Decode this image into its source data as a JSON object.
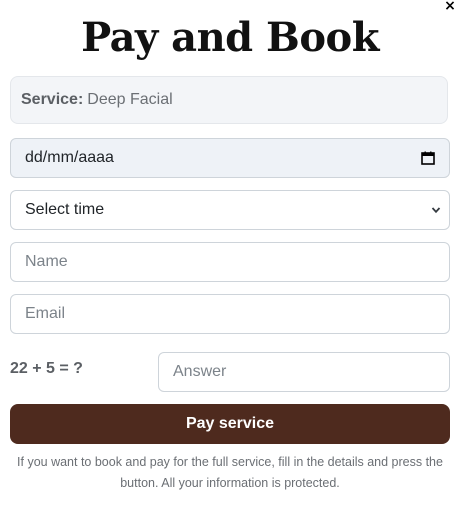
{
  "modal": {
    "close_symbol": "×",
    "title": "Pay and Book"
  },
  "service": {
    "label": "Service:",
    "value": "Deep Facial"
  },
  "date": {
    "placeholder": "dd/mm/aaaa",
    "icon": "calendar-icon"
  },
  "time": {
    "selected": "Select time",
    "icon": "chevron-down-icon"
  },
  "name": {
    "placeholder": "Name"
  },
  "email": {
    "placeholder": "Email"
  },
  "captcha": {
    "question": "22 + 5 = ?",
    "placeholder": "Answer"
  },
  "pay_button": {
    "label": "Pay service",
    "color": "#4e2a1e"
  },
  "info": {
    "text": "If you want to book and pay for the full service, fill in the details and press the button. All your information is protected."
  }
}
